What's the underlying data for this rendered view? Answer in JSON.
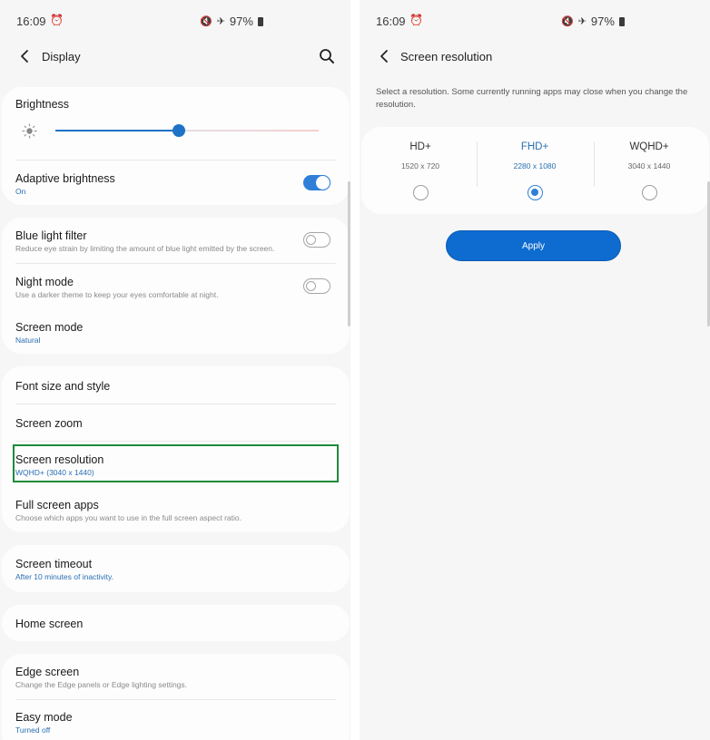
{
  "left": {
    "status": {
      "time": "16:09",
      "battery": "97%"
    },
    "appbar": {
      "title": "Display"
    },
    "brightness": {
      "label": "Brightness",
      "level_fraction": 0.47
    },
    "adaptive": {
      "title": "Adaptive brightness",
      "sub": "On",
      "on": true
    },
    "blue_light": {
      "title": "Blue light filter",
      "sub": "Reduce eye strain by limiting the amount of blue light emitted by the screen.",
      "on": false
    },
    "night_mode": {
      "title": "Night mode",
      "sub": "Use a darker theme to keep your eyes comfortable at night.",
      "on": false
    },
    "screen_mode": {
      "title": "Screen mode",
      "sub": "Natural"
    },
    "font_size": {
      "title": "Font size and style"
    },
    "screen_zoom": {
      "title": "Screen zoom"
    },
    "screen_resolution": {
      "title": "Screen resolution",
      "sub": "WQHD+ (3040 x 1440)"
    },
    "full_screen": {
      "title": "Full screen apps",
      "sub": "Choose which apps you want to use in the full screen aspect ratio."
    },
    "screen_timeout": {
      "title": "Screen timeout",
      "sub": "After 10 minutes of inactivity."
    },
    "home_screen": {
      "title": "Home screen"
    },
    "edge_screen": {
      "title": "Edge screen",
      "sub": "Change the Edge panels or Edge lighting settings."
    },
    "easy_mode": {
      "title": "Easy mode",
      "sub": "Turned off"
    }
  },
  "right": {
    "status": {
      "time": "16:09",
      "battery": "97%"
    },
    "appbar": {
      "title": "Screen resolution"
    },
    "description": "Select a resolution. Some currently running apps may close when you change the resolution.",
    "options": [
      {
        "name": "HD+",
        "dims": "1520 x 720",
        "selected": false
      },
      {
        "name": "FHD+",
        "dims": "2280 x 1080",
        "selected": true
      },
      {
        "name": "WQHD+",
        "dims": "3040 x 1440",
        "selected": false
      }
    ],
    "apply_label": "Apply"
  },
  "colors": {
    "accent": "#1e73c6",
    "highlight": "#1d8a3b"
  },
  "icons": [
    "back-arrow-icon",
    "search-icon",
    "alarm-icon",
    "mute-icon",
    "airplane-icon",
    "battery-icon",
    "sun-icon"
  ]
}
